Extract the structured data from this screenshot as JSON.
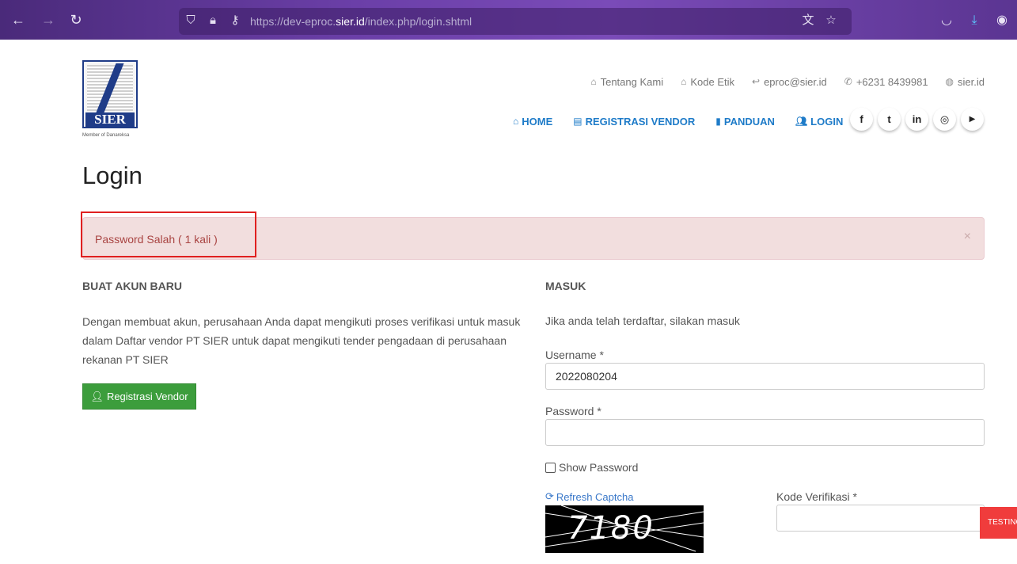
{
  "browser": {
    "url_prefix": "https://dev-eproc.",
    "url_domain": "sier.id",
    "url_path": "/index.php/login.shtml",
    "icons": [
      "back-icon",
      "forward-icon",
      "reload-icon",
      "shield-icon",
      "lock-icon",
      "key-icon",
      "translate-icon",
      "star-icon",
      "pocket-icon",
      "download-icon",
      "account-icon"
    ]
  },
  "logo": {
    "word": "SIER",
    "member_text": "Member of Danareksa"
  },
  "top_links": [
    {
      "label": "Tentang Kami",
      "icon": "home-icon"
    },
    {
      "label": "Kode Etik",
      "icon": "home-icon"
    },
    {
      "label": "eproc@sier.id",
      "icon": "reply-icon"
    },
    {
      "label": "+6231 8439981",
      "icon": "phone-icon"
    },
    {
      "label": "sier.id",
      "icon": "globe-icon"
    }
  ],
  "nav": [
    {
      "label": "HOME",
      "icon": "home-icon"
    },
    {
      "label": "REGISTRASI VENDOR",
      "icon": "id-card-icon"
    },
    {
      "label": "PANDUAN",
      "icon": "file-icon"
    },
    {
      "label": "LOGIN",
      "icon": "users-icon"
    }
  ],
  "socials": [
    {
      "glyph": "f",
      "icon": "facebook-icon"
    },
    {
      "glyph": "t",
      "icon": "twitter-icon"
    },
    {
      "glyph": "in",
      "icon": "linkedin-icon"
    },
    {
      "glyph": "◎",
      "icon": "instagram-icon"
    },
    {
      "glyph": "▶",
      "icon": "youtube-icon"
    }
  ],
  "page": {
    "title": "Login"
  },
  "alert": {
    "message": "Password Salah ( 1 kali )",
    "close": "×"
  },
  "left": {
    "heading": "BUAT AKUN BARU",
    "description": "Dengan membuat akun, perusahaan Anda dapat mengikuti proses verifikasi untuk masuk dalam Daftar vendor PT SIER untuk dapat mengikuti tender pengadaan di perusahaan rekanan PT SIER",
    "register_button": "Registrasi Vendor"
  },
  "right": {
    "heading": "MASUK",
    "description": "Jika anda telah terdaftar, silakan masuk",
    "username_label": "Username  *",
    "username_value": "2022080204",
    "password_label": "Password  *",
    "password_value": "",
    "show_password_label": "Show Password",
    "refresh_captcha": "Refresh Captcha",
    "captcha_text": "7180",
    "verification_label": "Kode Verifikasi  *",
    "verification_value": ""
  },
  "badge": {
    "label": "TESTING"
  }
}
